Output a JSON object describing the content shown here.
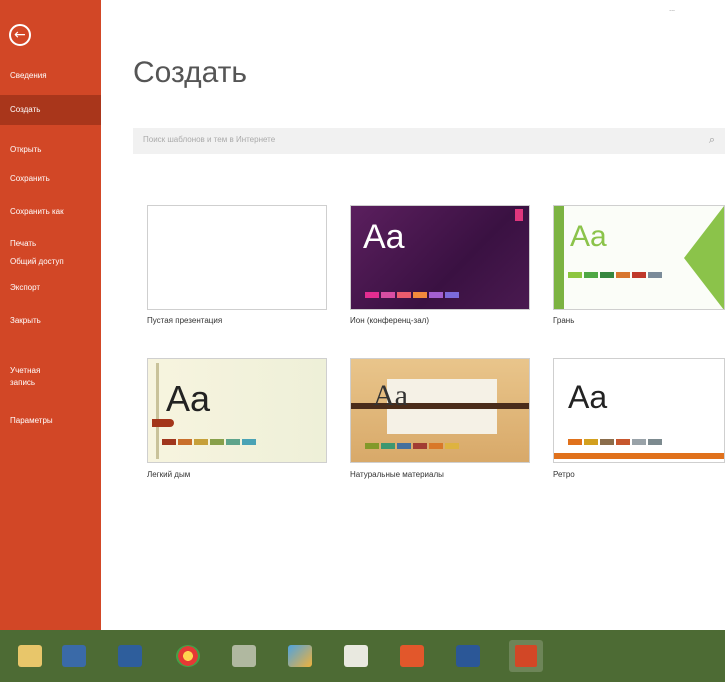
{
  "sidebar": {
    "back_icon": "back-arrow-icon",
    "items": [
      {
        "label": "Сведения"
      },
      {
        "label": "Создать"
      },
      {
        "label": "Открыть"
      },
      {
        "label": "Сохранить"
      },
      {
        "label": "Сохранить как"
      },
      {
        "label": "Печать"
      },
      {
        "label": "Общий доступ"
      },
      {
        "label": "Экспорт"
      },
      {
        "label": "Закрыть"
      },
      {
        "label": "Учетная запись"
      },
      {
        "label": "Параметры"
      }
    ],
    "active_item": "Создать",
    "color": "#d24726",
    "active_color": "#a9361b"
  },
  "header": {
    "user": "..."
  },
  "main": {
    "title": "Создать",
    "search": {
      "placeholder": "Поиск шаблонов и тем в Интернете",
      "icon": "search-icon"
    },
    "templates": [
      {
        "label": "Пустая презентация",
        "preview": ""
      },
      {
        "label": "Ион (конференц-зал)",
        "preview": "Aa"
      },
      {
        "label": "Грань",
        "preview": "Aa"
      },
      {
        "label": "Легкий дым",
        "preview": "Aa"
      },
      {
        "label": "Натуральные материалы",
        "preview": "Aa"
      },
      {
        "label": "Ретро",
        "preview": "Aa"
      }
    ]
  },
  "taskbar": {
    "icons": [
      "file-explorer-icon",
      "save-icon",
      "outlook-icon",
      "chrome-icon",
      "tools-icon",
      "paint-icon",
      "calendar-icon",
      "contacts-icon",
      "word-icon",
      "powerpoint-icon"
    ],
    "color": "#4d6b34"
  }
}
